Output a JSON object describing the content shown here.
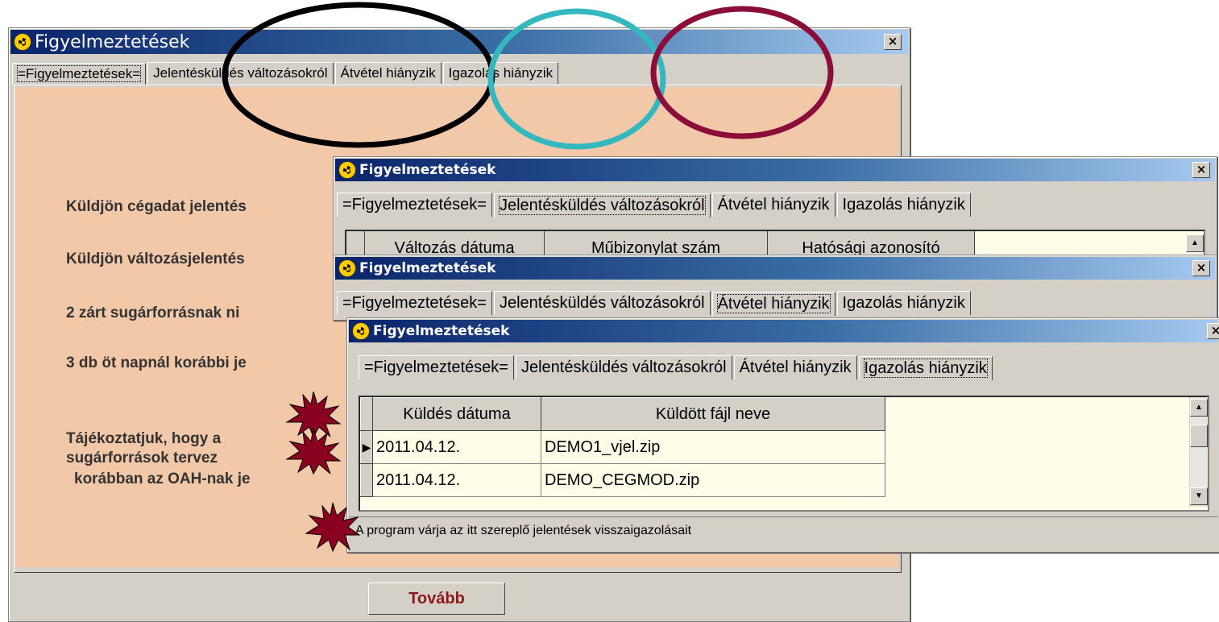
{
  "colors": {
    "panel_peach": "#f2c9a8",
    "grid_yellow": "#fffde8",
    "title_dark": "#0a246a",
    "title_light": "#a6caf0",
    "burst": "#8b0020",
    "circle_black": "#000000",
    "circle_teal": "#33b8c0",
    "circle_maroon": "#8b0d3a"
  },
  "icons": {
    "title": "radiation-icon",
    "close": "close-x-icon",
    "burst": "starburst-icon",
    "row_pointer": "row-pointer-icon"
  },
  "win1": {
    "title": "Figyelmeztetések",
    "close": "×",
    "tabs": [
      "=Figyelmeztetések=",
      "Jelentésküldés változásokról",
      "Átvétel hiányzik",
      "Igazolás hiányzik"
    ],
    "lines": [
      "Küldjön cégadat jelentés",
      "Küldjön változásjelentés",
      "2 zárt sugárforrásnak ni",
      "3 db öt napnál korábbi je"
    ],
    "info": [
      "Tájékoztatjuk, hogy a",
      "sugárforrások tervez",
      "korábban az OAH-nak je"
    ],
    "button": "Tovább"
  },
  "win2": {
    "title": "Figyelmeztetések",
    "close": "×",
    "tabs": [
      "=Figyelmeztetések=",
      "Jelentésküldés változásokról",
      "Átvétel hiányzik",
      "Igazolás hiányzik"
    ],
    "headers": [
      "Változás dátuma",
      "Műbizonylat szám",
      "Hatósági azonosító"
    ]
  },
  "win3": {
    "title": "Figyelmeztetések",
    "close": "×",
    "tabs": [
      "=Figyelmeztetések=",
      "Jelentésküldés változásokról",
      "Átvétel hiányzik",
      "Igazolás hiányzik"
    ]
  },
  "win4": {
    "title": "Figyelmeztetések",
    "close": "×",
    "tabs": [
      "=Figyelmeztetések=",
      "Jelentésküldés változásokról",
      "Átvétel hiányzik",
      "Igazolás hiányzik"
    ],
    "headers": [
      "Küldés dátuma",
      "Küldött fájl neve"
    ],
    "rows": [
      {
        "date": "2011.04.12.",
        "file": "DEMO1_vjel.zip"
      },
      {
        "date": "2011.04.12.",
        "file": "DEMO_CEGMOD.zip"
      }
    ],
    "status": "A program várja az itt szereplő jelentések visszaigazolásait"
  }
}
